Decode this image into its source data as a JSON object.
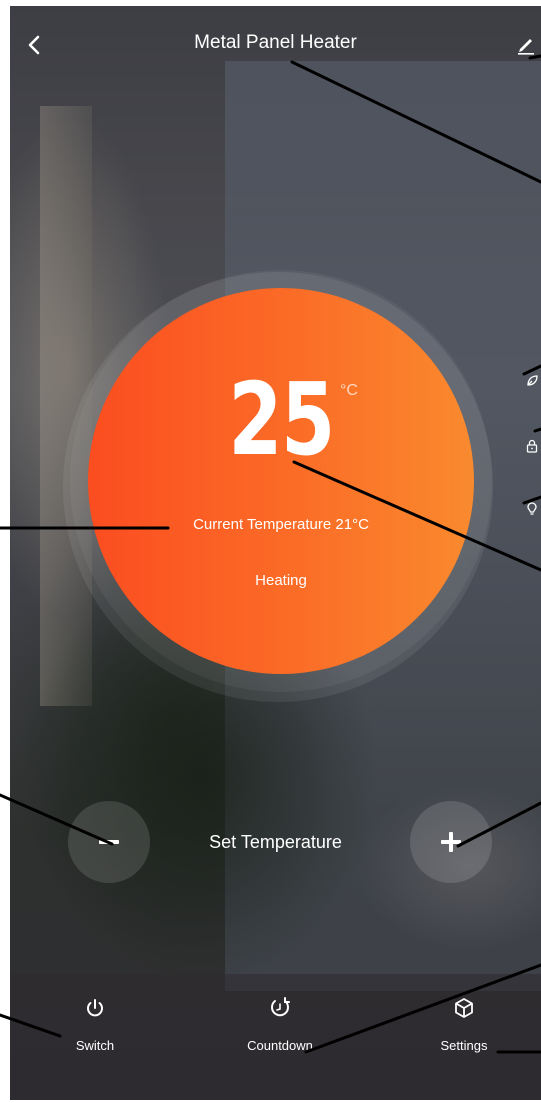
{
  "header": {
    "title": "Metal Panel Heater",
    "back_icon": "chevron-left-icon",
    "edit_icon": "pencil-icon"
  },
  "dial": {
    "set_temperature": "25",
    "unit": "°C",
    "current_temperature_text": "Current Temperature 21°C",
    "status": "Heating",
    "colors": {
      "start": "#fb4d20",
      "end": "#f98a2e"
    }
  },
  "side_icons": [
    "leaf-icon",
    "lock-icon",
    "bulb-icon"
  ],
  "controls": {
    "decrease_icon": "minus-icon",
    "increase_icon": "plus-icon",
    "label": "Set Temperature"
  },
  "bottom_tabs": [
    {
      "label": "Switch",
      "icon": "power-icon"
    },
    {
      "label": "Countdown",
      "icon": "countdown-icon"
    },
    {
      "label": "Settings",
      "icon": "cube-icon"
    }
  ]
}
